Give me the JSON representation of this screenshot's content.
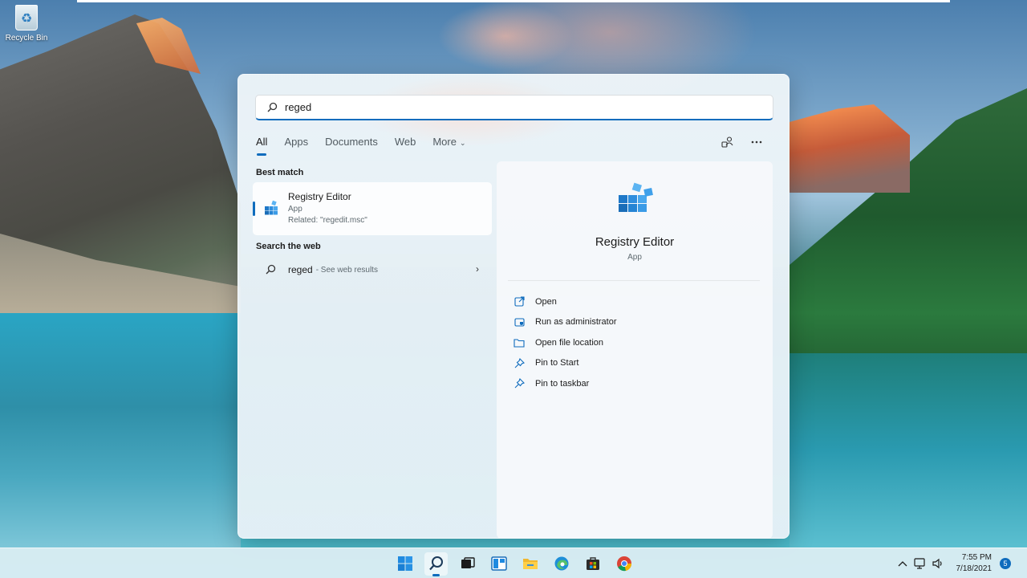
{
  "desktop": {
    "recycle_bin_label": "Recycle Bin"
  },
  "search": {
    "query": "reged",
    "tabs": [
      {
        "label": "All",
        "active": true
      },
      {
        "label": "Apps",
        "active": false
      },
      {
        "label": "Documents",
        "active": false
      },
      {
        "label": "Web",
        "active": false
      },
      {
        "label": "More",
        "active": false
      }
    ],
    "toolbar_icons": [
      "share-account-icon",
      "more-options-icon"
    ],
    "best_match": {
      "section_label": "Best match",
      "title": "Registry Editor",
      "type": "App",
      "related": "Related: \"regedit.msc\"",
      "icon": "registry-editor-icon"
    },
    "web": {
      "section_label": "Search the web",
      "query": "reged",
      "suffix": "- See web results"
    }
  },
  "detail": {
    "title": "Registry Editor",
    "type": "App",
    "actions": [
      {
        "label": "Open",
        "icon": "open-external-icon"
      },
      {
        "label": "Run as administrator",
        "icon": "shield-admin-icon"
      },
      {
        "label": "Open file location",
        "icon": "folder-icon"
      },
      {
        "label": "Pin to Start",
        "icon": "pin-icon"
      },
      {
        "label": "Pin to taskbar",
        "icon": "pin-icon"
      }
    ]
  },
  "taskbar": {
    "apps": [
      "start-icon",
      "search-icon",
      "task-view-icon",
      "widgets-icon",
      "file-explorer-icon",
      "edge-icon",
      "store-icon",
      "chrome-icon"
    ],
    "clock_time": "7:55 PM",
    "clock_date": "7/18/2021",
    "notification_count": "5"
  },
  "colors": {
    "accent": "#0f6cbd",
    "panel_bg": "#edf4f8",
    "taskbar_bg": "#daecf3"
  }
}
